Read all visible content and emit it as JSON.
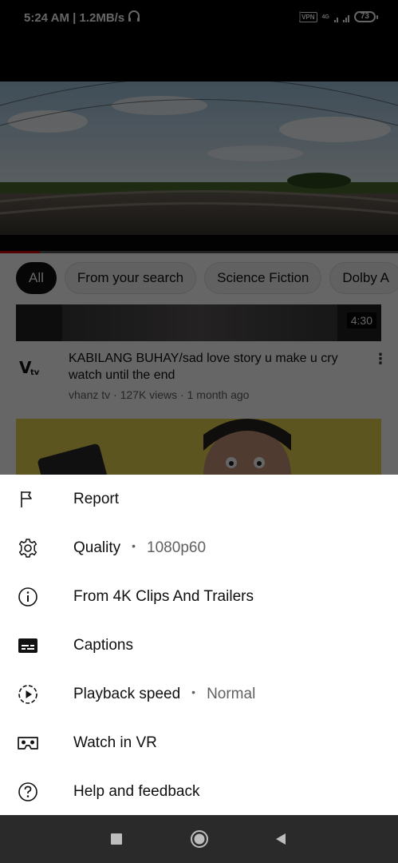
{
  "status_bar": {
    "time_speed": "5:24 AM | 1.2MB/s",
    "vpn": "VPN",
    "network": "4G",
    "battery": "73"
  },
  "player": {
    "progress": 0.1
  },
  "chips": [
    {
      "label": "All",
      "active": true
    },
    {
      "label": "From your search",
      "active": false
    },
    {
      "label": "Science Fiction",
      "active": false
    },
    {
      "label": "Dolby A",
      "active": false
    }
  ],
  "video": {
    "duration": "4:30",
    "title": "KABILANG BUHAY/sad love story u make u cry watch until the end",
    "meta": "vhanz tv · 127K views · 1 month ago"
  },
  "menu": [
    {
      "label": "Report",
      "value": "",
      "icon": "flag-icon"
    },
    {
      "label": "Quality",
      "value": "1080p60",
      "icon": "gear-icon"
    },
    {
      "label": "From 4K Clips And Trailers",
      "value": "",
      "icon": "info-icon"
    },
    {
      "label": "Captions",
      "value": "",
      "icon": "captions-icon"
    },
    {
      "label": "Playback speed",
      "value": "Normal",
      "icon": "playback-speed-icon"
    },
    {
      "label": "Watch in VR",
      "value": "",
      "icon": "vr-headset-icon"
    },
    {
      "label": "Help and feedback",
      "value": "",
      "icon": "help-icon"
    }
  ],
  "colors": {
    "accent": "#cc0000",
    "sheet_bg": "#ffffff",
    "navbar_bg": "#2a2a2a"
  }
}
